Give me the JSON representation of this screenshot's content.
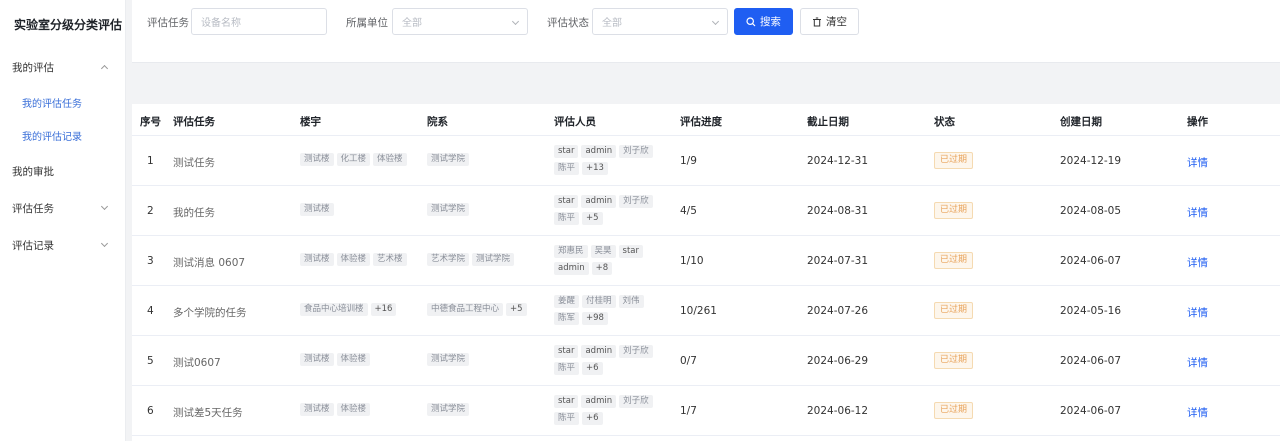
{
  "sidebar": {
    "title": "实验室分级分类评估",
    "items": [
      {
        "label": "我的评估",
        "expanded": true,
        "children": [
          {
            "label": "我的评估任务"
          },
          {
            "label": "我的评估记录"
          }
        ]
      },
      {
        "label": "我的审批"
      },
      {
        "label": "评估任务"
      },
      {
        "label": "评估记录"
      }
    ]
  },
  "filters": {
    "task_label": "评估任务",
    "task_placeholder": "设备名称",
    "unit_label": "所属单位",
    "unit_value": "全部",
    "status_label": "评估状态",
    "status_value": "全部",
    "search_button": "搜索",
    "clear_button": "清空"
  },
  "table": {
    "columns": [
      "序号",
      "评估任务",
      "楼宇",
      "院系",
      "评估人员",
      "评估进度",
      "截止日期",
      "状态",
      "创建日期",
      "操作"
    ],
    "rows": [
      {
        "index": "1",
        "task": "测试任务",
        "buildings": [
          "测试楼",
          "化工楼",
          "体验楼"
        ],
        "departments": [
          "测试学院"
        ],
        "people": [
          [
            "star",
            "admin",
            "刘子欣"
          ],
          [
            "陈平",
            "+13"
          ]
        ],
        "progress": "1/9",
        "deadline": "2024-12-31",
        "status": "已过期",
        "created": "2024-12-19",
        "action": "详情"
      },
      {
        "index": "2",
        "task": "我的任务",
        "buildings": [
          "测试楼"
        ],
        "departments": [
          "测试学院"
        ],
        "people": [
          [
            "star",
            "admin",
            "刘子欣"
          ],
          [
            "陈平",
            "+5"
          ]
        ],
        "progress": "4/5",
        "deadline": "2024-08-31",
        "status": "已过期",
        "created": "2024-08-05",
        "action": "详情"
      },
      {
        "index": "3",
        "task": "测试消息 0607",
        "buildings": [
          "测试楼",
          "体验楼",
          "艺术楼"
        ],
        "departments": [
          "艺术学院",
          "测试学院"
        ],
        "people": [
          [
            "郑惠民",
            "吴昊",
            "star"
          ],
          [
            "admin",
            "+8"
          ]
        ],
        "progress": "1/10",
        "deadline": "2024-07-31",
        "status": "已过期",
        "created": "2024-06-07",
        "action": "详情"
      },
      {
        "index": "4",
        "task": "多个学院的任务",
        "buildings": [
          "食品中心培训楼",
          "+16"
        ],
        "departments": [
          "中德食品工程中心",
          "+5"
        ],
        "people": [
          [
            "姜醒",
            "付桂明",
            "刘伟"
          ],
          [
            "陈军",
            "+98"
          ]
        ],
        "progress": "10/261",
        "deadline": "2024-07-26",
        "status": "已过期",
        "created": "2024-05-16",
        "action": "详情"
      },
      {
        "index": "5",
        "task": "测试0607",
        "buildings": [
          "测试楼",
          "体验楼"
        ],
        "departments": [
          "测试学院"
        ],
        "people": [
          [
            "star",
            "admin",
            "刘子欣"
          ],
          [
            "陈平",
            "+6"
          ]
        ],
        "progress": "0/7",
        "deadline": "2024-06-29",
        "status": "已过期",
        "created": "2024-06-07",
        "action": "详情"
      },
      {
        "index": "6",
        "task": "测试差5天任务",
        "buildings": [
          "测试楼",
          "体验楼"
        ],
        "departments": [
          "测试学院"
        ],
        "people": [
          [
            "star",
            "admin",
            "刘子欣"
          ],
          [
            "陈平",
            "+6"
          ]
        ],
        "progress": "1/7",
        "deadline": "2024-06-12",
        "status": "已过期",
        "created": "2024-06-07",
        "action": "详情"
      }
    ]
  }
}
